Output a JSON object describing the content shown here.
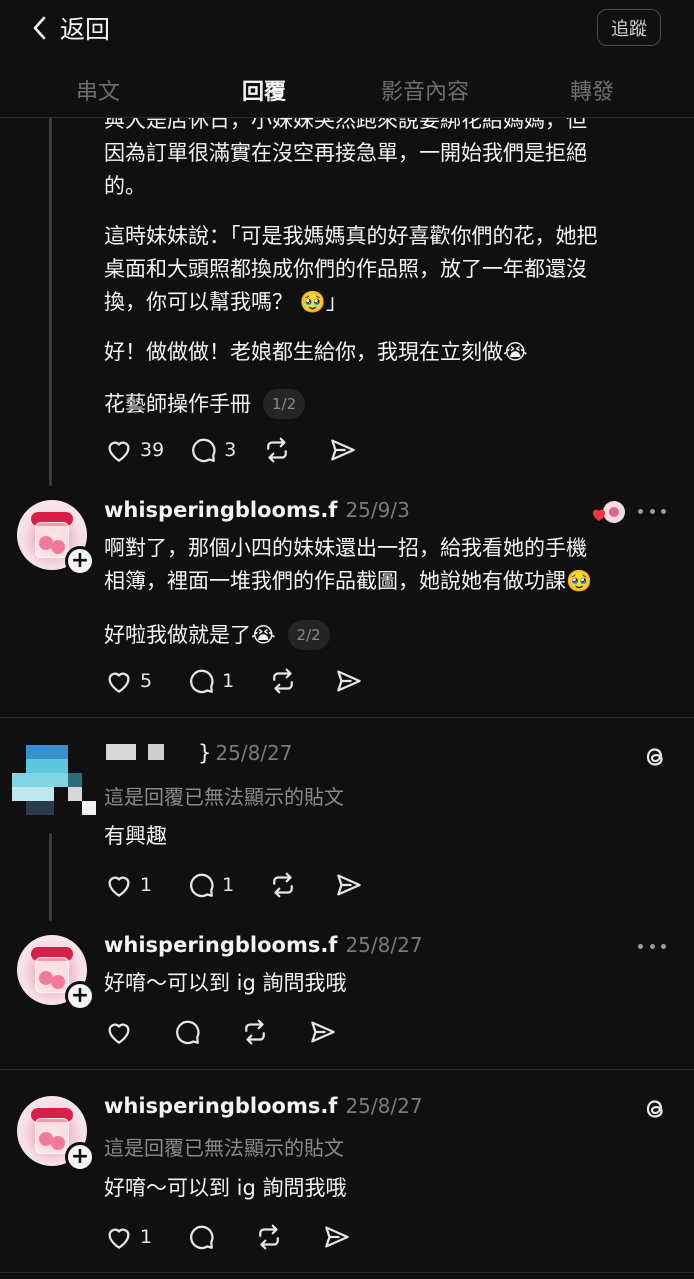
{
  "header": {
    "back_label": "返回",
    "follow_label": "追蹤",
    "tabs": [
      "串文",
      "回覆",
      "影音內容",
      "轉發"
    ],
    "active_tab": 1
  },
  "post1": {
    "lines": [
      "與大是店休日，小妹妹突然跑來說要綁花給媽媽，但",
      "因為訂單很滿實在沒空再接急單，一開始我們是拒絕",
      "的。",
      "這時妹妹說：「可是我媽媽真的好喜歡你們的花，她把",
      "桌面和大頭照都換成你們的作品照，放了一年都還沒",
      "換，你可以幫我嗎？ 🥹」",
      "好！做做做！老娘都生給你，我現在立刻做😭"
    ],
    "tag": "花藝師操作手冊",
    "pager": "1/2",
    "likes": "39",
    "replies": "3"
  },
  "post2": {
    "username": "whisperingblooms.f",
    "date": "25/9/3",
    "lines": [
      "啊對了，那個小四的妹妹還出一招，給我看她的手機",
      "相簿，裡面一堆我們的作品截圖，她說她有做功課🥹"
    ],
    "last_line": "好啦我做就是了😭",
    "pager": "2/2",
    "likes": "5",
    "replies": "1"
  },
  "reply1": {
    "date": "25/8/27",
    "sub": "這是回覆已無法顯示的貼文",
    "text": "有興趣",
    "likes": "1",
    "replies": "1"
  },
  "reply2": {
    "username": "whisperingblooms.f",
    "date": "25/8/27",
    "text": "好唷～可以到 ig 詢問我哦"
  },
  "reply3": {
    "username": "whisperingblooms.f",
    "date": "25/8/27",
    "sub": "這是回覆已無法顯示的貼文",
    "text": "好唷～可以到 ig 詢問我哦",
    "likes": "1"
  }
}
